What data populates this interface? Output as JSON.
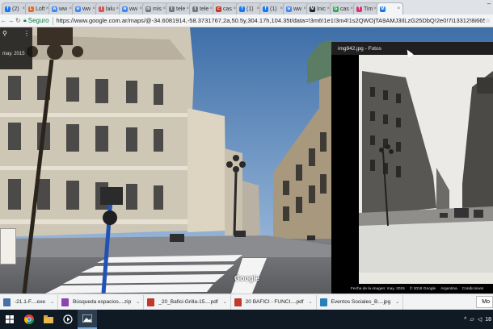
{
  "browser": {
    "tabs": [
      {
        "label": "(2)",
        "color": "#1877f2",
        "glyph": "f"
      },
      {
        "label": "Loft",
        "color": "#e06c2b",
        "glyph": "L"
      },
      {
        "label": "ww",
        "color": "#4285f4",
        "glyph": "w"
      },
      {
        "label": "ww",
        "color": "#4285f4",
        "glyph": "w"
      },
      {
        "label": "lalu",
        "color": "#d9534f",
        "glyph": "l"
      },
      {
        "label": "ww",
        "color": "#4285f4",
        "glyph": "w"
      },
      {
        "label": "mis",
        "color": "#777777",
        "glyph": "m"
      },
      {
        "label": "tele",
        "color": "#777777",
        "glyph": "t"
      },
      {
        "label": "tele",
        "color": "#777777",
        "glyph": "t"
      },
      {
        "label": "cas",
        "color": "#c0392b",
        "glyph": "c"
      },
      {
        "label": "(1)",
        "color": "#1877f2",
        "glyph": "f"
      },
      {
        "label": "(1)",
        "color": "#1877f2",
        "glyph": "f"
      },
      {
        "label": "ww",
        "color": "#4285f4",
        "glyph": "w"
      },
      {
        "label": "Inic",
        "color": "#222222",
        "glyph": "M"
      },
      {
        "label": "cas",
        "color": "#34a853",
        "glyph": "G"
      },
      {
        "label": "Tim",
        "color": "#e1306c",
        "glyph": "T"
      },
      {
        "label": "",
        "color": "#1a73e8",
        "glyph": "M",
        "active": true
      }
    ],
    "secure_label": "Seguro",
    "url": "https://www.google.com.ar/maps/@-34.6081914,-58.3731767,2a,50.5y,304.17h,104.35t/data=!3m6!1e1!3m4!1s2QWOjTA9AMJ3IlLzG25DbQ!2e0!7i13312!8i6656"
  },
  "streetview": {
    "date": "may. 2015",
    "logo": "Google"
  },
  "photos": {
    "title": "img942.jpg - Fotos",
    "footer": [
      "Fecha de la imagen: may. 2015",
      "© 2018 Google",
      "Argentina",
      "Condiciones"
    ]
  },
  "downloads": [
    {
      "name": "-21.1-F....exe",
      "color": "#4a6fa5"
    },
    {
      "name": "Búsqueda espacios....zip",
      "color": "#8e44ad"
    },
    {
      "name": "_20_Bafici-Grilla-15....pdf",
      "color": "#c0392b"
    },
    {
      "name": "20 BAFICI - FUNCI....pdf",
      "color": "#c0392b"
    },
    {
      "name": "Eventos Sociales_B....jpg",
      "color": "#2980b9"
    }
  ],
  "downloads_more": "Mo",
  "taskbar": {
    "icons": [
      "windows-start",
      "chrome",
      "file-explorer",
      "media",
      "photos"
    ],
    "clock": "18"
  }
}
